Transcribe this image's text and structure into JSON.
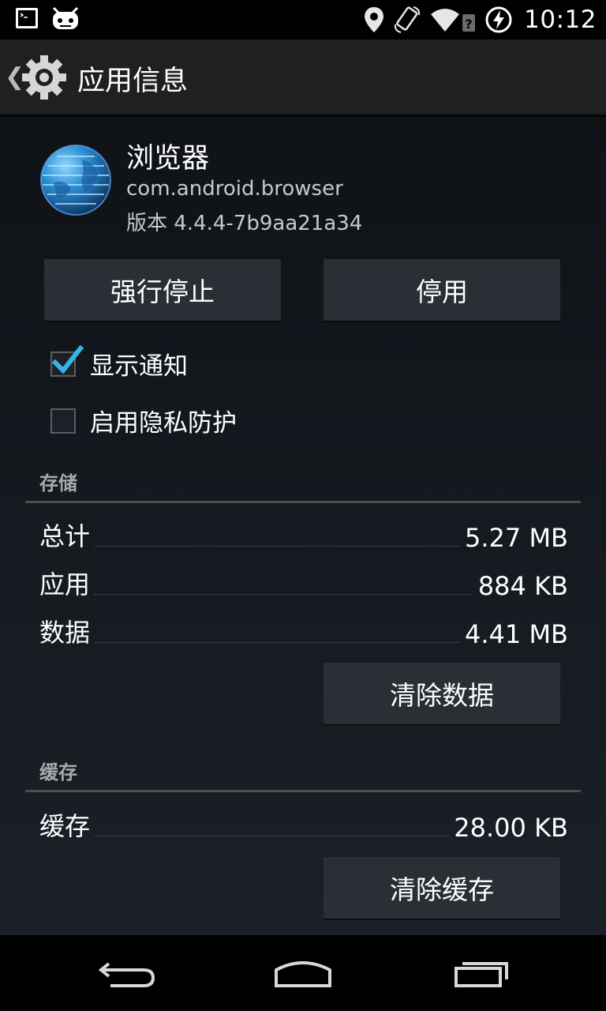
{
  "status_bar": {
    "left_icons": [
      "terminal-icon",
      "android-icon"
    ],
    "right_icons": [
      "location-icon",
      "rotate-icon",
      "wifi-icon",
      "battery-charging-icon"
    ],
    "time": "10:12"
  },
  "action_bar": {
    "title": "应用信息",
    "icons": [
      "back-chevron-icon",
      "gear-icon"
    ]
  },
  "app": {
    "name": "浏览器",
    "package": "com.android.browser",
    "version": "版本 4.4.4-7b9aa21a34",
    "icon": "globe-icon"
  },
  "buttons": {
    "force_stop": "强行停止",
    "disable": "停用",
    "clear_data": "清除数据",
    "clear_cache": "清除缓存"
  },
  "checkboxes": [
    {
      "label": "显示通知",
      "checked": true
    },
    {
      "label": "启用隐私防护",
      "checked": false
    }
  ],
  "storage": {
    "heading": "存储",
    "rows": [
      {
        "label": "总计",
        "value": "5.27 MB"
      },
      {
        "label": "应用",
        "value": "884 KB"
      },
      {
        "label": "数据",
        "value": "4.41 MB"
      }
    ]
  },
  "cache": {
    "heading": "缓存",
    "rows": [
      {
        "label": "缓存",
        "value": "28.00 KB"
      }
    ]
  },
  "nav_bar": {
    "icons": [
      "back-icon",
      "home-icon",
      "recents-icon"
    ]
  },
  "colors": {
    "accent_check": "#33b5e5",
    "background": "#151a20",
    "button": "#2a2f36"
  }
}
